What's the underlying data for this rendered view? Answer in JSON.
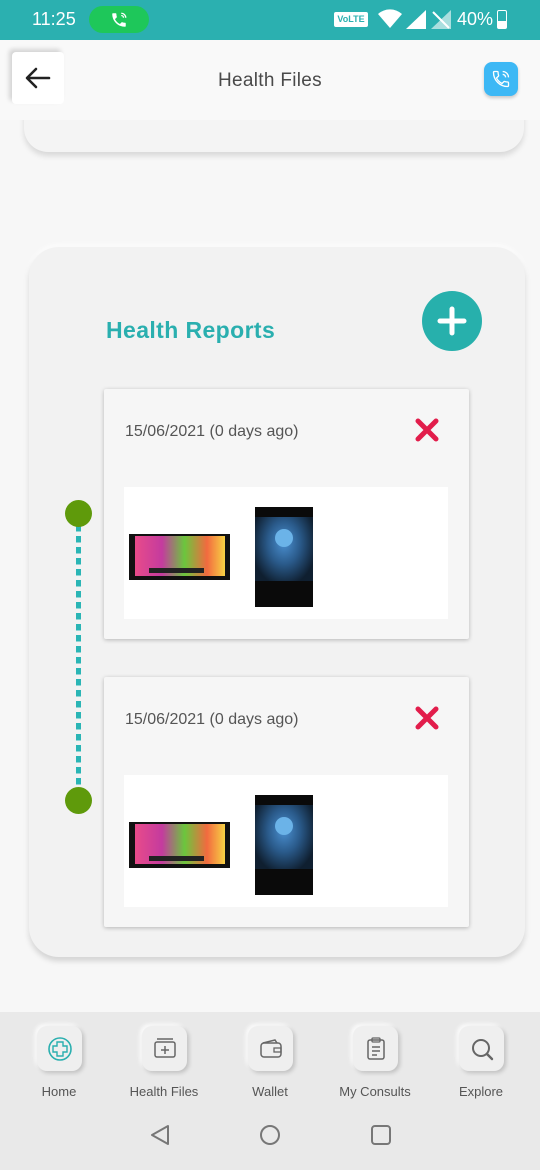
{
  "status_bar": {
    "time": "11:25",
    "network_badge": "VoLTE",
    "battery": "40%"
  },
  "header": {
    "title": "Health Files",
    "back_icon": "arrow-left-icon",
    "call_icon": "phone-icon"
  },
  "reports": {
    "title": "Health Reports",
    "add_icon": "plus-icon",
    "items": [
      {
        "date": "15/06/2021 (0 days ago)",
        "delete_icon": "close-x-icon"
      },
      {
        "date": "15/06/2021 (0 days ago)",
        "delete_icon": "close-x-icon"
      }
    ]
  },
  "bottom_nav": {
    "items": [
      {
        "label": "Home",
        "icon": "home-plus-icon"
      },
      {
        "label": "Health Files",
        "icon": "folder-plus-icon"
      },
      {
        "label": "Wallet",
        "icon": "wallet-icon"
      },
      {
        "label": "My Consults",
        "icon": "clipboard-icon"
      },
      {
        "label": "Explore",
        "icon": "search-icon"
      }
    ]
  },
  "colors": {
    "accent": "#2aafaf",
    "status_bar": "#2bb0b0",
    "timeline_dot": "#5f9a0b",
    "delete": "#e21d4b",
    "call_button": "#3db8f5"
  }
}
